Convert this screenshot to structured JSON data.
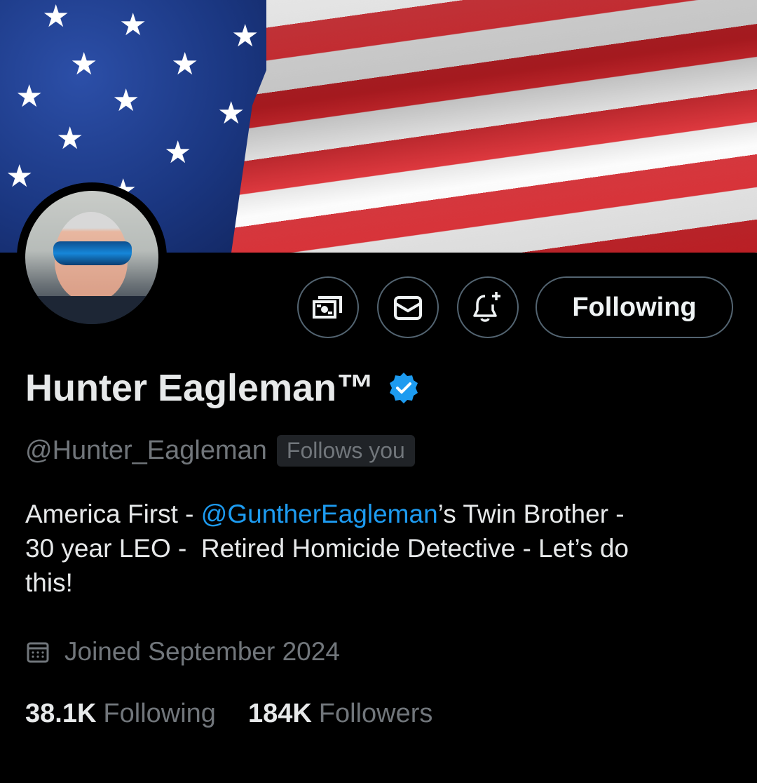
{
  "profile": {
    "display_name": "Hunter Eagleman™",
    "handle": "@Hunter_Eagleman",
    "follows_you_badge": "Follows you",
    "verified_color": "#1d9bf0",
    "bio": {
      "part1": "America First - ",
      "mention": "@GuntherEagleman",
      "part2": "’s Twin Brother - \n30 year LEO -  Retired Homicide Detective - Let’s do\nthis!"
    },
    "joined": "Joined September 2024",
    "stats": {
      "following_count": "38.1K",
      "following_label": "Following",
      "followers_count": "184K",
      "followers_label": "Followers"
    }
  },
  "actions": {
    "subscribe_icon": "money-icon",
    "message_icon": "mail-icon",
    "notify_icon": "bell-plus-icon",
    "follow_label": "Following"
  },
  "colors": {
    "background": "#000000",
    "accent": "#1d9bf0",
    "muted_text": "#71767b",
    "border": "#536471"
  }
}
